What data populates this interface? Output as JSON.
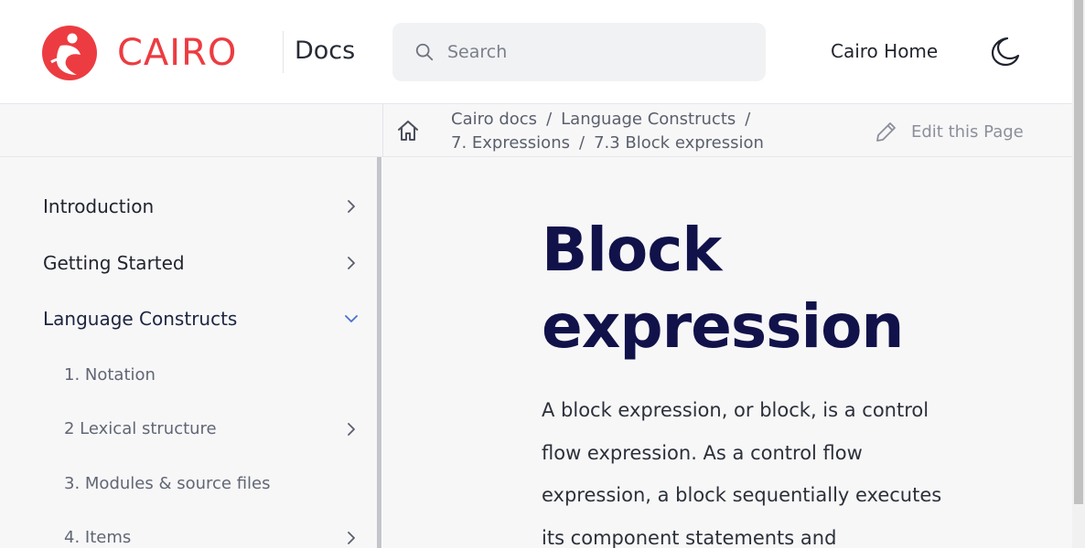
{
  "header": {
    "logo_text": "CAIRO",
    "docs_label": "Docs",
    "search": {
      "placeholder": "Search"
    },
    "home_link": "Cairo Home",
    "theme_icon": "moon-icon"
  },
  "breadcrumb": {
    "items": [
      "Cairo docs",
      "Language Constructs",
      "7. Expressions",
      "7.3 Block expression"
    ],
    "separator": "/",
    "edit_label": "Edit this Page"
  },
  "sidebar": {
    "items": [
      {
        "label": "Introduction",
        "chevron": "right"
      },
      {
        "label": "Getting Started",
        "chevron": "right"
      },
      {
        "label": "Language Constructs",
        "chevron": "down"
      },
      {
        "label": "1. Notation",
        "chevron": ""
      },
      {
        "label": "2 Lexical structure",
        "chevron": "right"
      },
      {
        "label": "3. Modules & source files",
        "chevron": ""
      },
      {
        "label": "4. Items",
        "chevron": "right"
      }
    ]
  },
  "content": {
    "title_line1": "Block",
    "title_line2": "expression",
    "paragraph": "A block expression, or block, is a control flow expression. As a control flow expression, a block sequentially executes its component statements and"
  },
  "colors": {
    "brand": "#ec3c41",
    "title": "#11124a",
    "accent_chevron": "#4a6fd1"
  }
}
